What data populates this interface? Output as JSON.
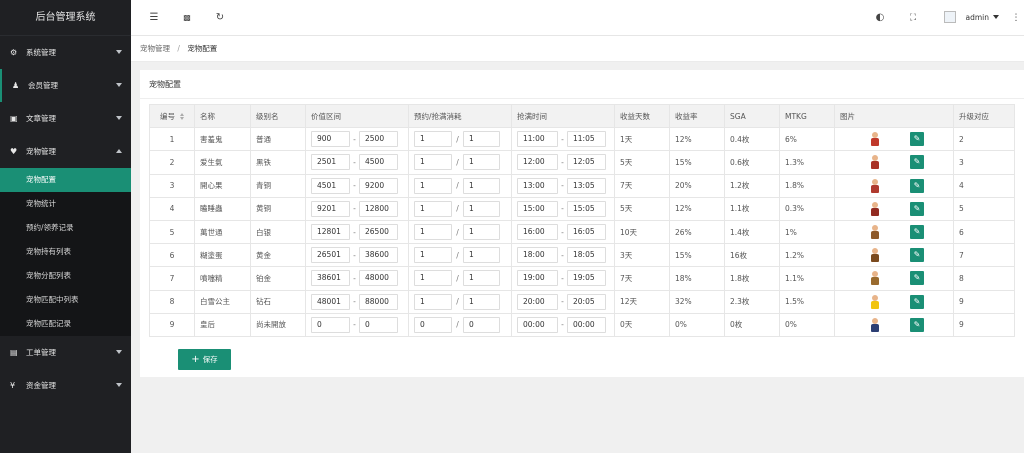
{
  "sidebar": {
    "title": "后台管理系统",
    "groups": [
      {
        "label": "系统管理",
        "icon": "gear-icon",
        "glyph": "⚙"
      },
      {
        "label": "会员管理",
        "icon": "users-icon",
        "glyph": "👥"
      },
      {
        "label": "文章管理",
        "icon": "copy-icon",
        "glyph": "▣"
      },
      {
        "label": "宠物管理",
        "icon": "heart-icon",
        "glyph": "♥"
      },
      {
        "label": "工单管理",
        "icon": "document-icon",
        "glyph": "▤"
      },
      {
        "label": "资金管理",
        "icon": "yen-icon",
        "glyph": "¥"
      }
    ],
    "pet_submenu": [
      "宠物配置",
      "宠物统计",
      "预约/领养记录",
      "宠物持有列表",
      "宠物分配列表",
      "宠物匹配中列表",
      "宠物匹配记录"
    ]
  },
  "topbar": {
    "username": "admin"
  },
  "breadcrumb": {
    "parent": "宠物管理",
    "separator": "/",
    "current": "宠物配置"
  },
  "card": {
    "title": "宠物配置",
    "save_label": "保存",
    "save_icon": "+"
  },
  "table": {
    "headers": [
      "编号",
      "名称",
      "级别名",
      "价值区间",
      "预约/抢满消耗",
      "抢满时间",
      "收益天数",
      "收益率",
      "SGA",
      "MTKG",
      "图片",
      "升级对应"
    ],
    "rows": [
      {
        "id": "1",
        "name": "害羞鬼",
        "level": "普通",
        "vmin": "900",
        "vmax": "2500",
        "c1": "1",
        "c2": "1",
        "t1": "11:00",
        "t2": "11:05",
        "days": "1天",
        "rate": "12%",
        "sga": "0.4枚",
        "mtkg": "6%",
        "upgrade": "2"
      },
      {
        "id": "2",
        "name": "爱生氣",
        "level": "黑铁",
        "vmin": "2501",
        "vmax": "4500",
        "c1": "1",
        "c2": "1",
        "t1": "12:00",
        "t2": "12:05",
        "days": "5天",
        "rate": "15%",
        "sga": "0.6枚",
        "mtkg": "1.3%",
        "upgrade": "3"
      },
      {
        "id": "3",
        "name": "開心果",
        "level": "青铜",
        "vmin": "4501",
        "vmax": "9200",
        "c1": "1",
        "c2": "1",
        "t1": "13:00",
        "t2": "13:05",
        "days": "7天",
        "rate": "20%",
        "sga": "1.2枚",
        "mtkg": "1.8%",
        "upgrade": "4"
      },
      {
        "id": "4",
        "name": "瞌睡蟲",
        "level": "黄铜",
        "vmin": "9201",
        "vmax": "12800",
        "c1": "1",
        "c2": "1",
        "t1": "15:00",
        "t2": "15:05",
        "days": "5天",
        "rate": "12%",
        "sga": "1.1枚",
        "mtkg": "0.3%",
        "upgrade": "5"
      },
      {
        "id": "5",
        "name": "萬世通",
        "level": "白银",
        "vmin": "12801",
        "vmax": "26500",
        "c1": "1",
        "c2": "1",
        "t1": "16:00",
        "t2": "16:05",
        "days": "10天",
        "rate": "26%",
        "sga": "1.4枚",
        "mtkg": "1%",
        "upgrade": "6"
      },
      {
        "id": "6",
        "name": "糊塗蛋",
        "level": "黄金",
        "vmin": "26501",
        "vmax": "38600",
        "c1": "1",
        "c2": "1",
        "t1": "18:00",
        "t2": "18:05",
        "days": "3天",
        "rate": "15%",
        "sga": "16枚",
        "mtkg": "1.2%",
        "upgrade": "7"
      },
      {
        "id": "7",
        "name": "噴嚏精",
        "level": "铂金",
        "vmin": "38601",
        "vmax": "48000",
        "c1": "1",
        "c2": "1",
        "t1": "19:00",
        "t2": "19:05",
        "days": "7天",
        "rate": "18%",
        "sga": "1.8枚",
        "mtkg": "1.1%",
        "upgrade": "8"
      },
      {
        "id": "8",
        "name": "白雪公主",
        "level": "钻石",
        "vmin": "48001",
        "vmax": "88000",
        "c1": "1",
        "c2": "1",
        "t1": "20:00",
        "t2": "20:05",
        "days": "12天",
        "rate": "32%",
        "sga": "2.3枚",
        "mtkg": "1.5%",
        "upgrade": "9"
      },
      {
        "id": "9",
        "name": "皇后",
        "level": "尚未開放",
        "vmin": "0",
        "vmax": "0",
        "c1": "0",
        "c2": "0",
        "t1": "00:00",
        "t2": "00:00",
        "days": "0天",
        "rate": "0%",
        "sga": "0枚",
        "mtkg": "0%",
        "upgrade": "9"
      }
    ]
  },
  "colors": {
    "accent": "#1a8f75",
    "sidebar_bg": "#1f2023"
  }
}
